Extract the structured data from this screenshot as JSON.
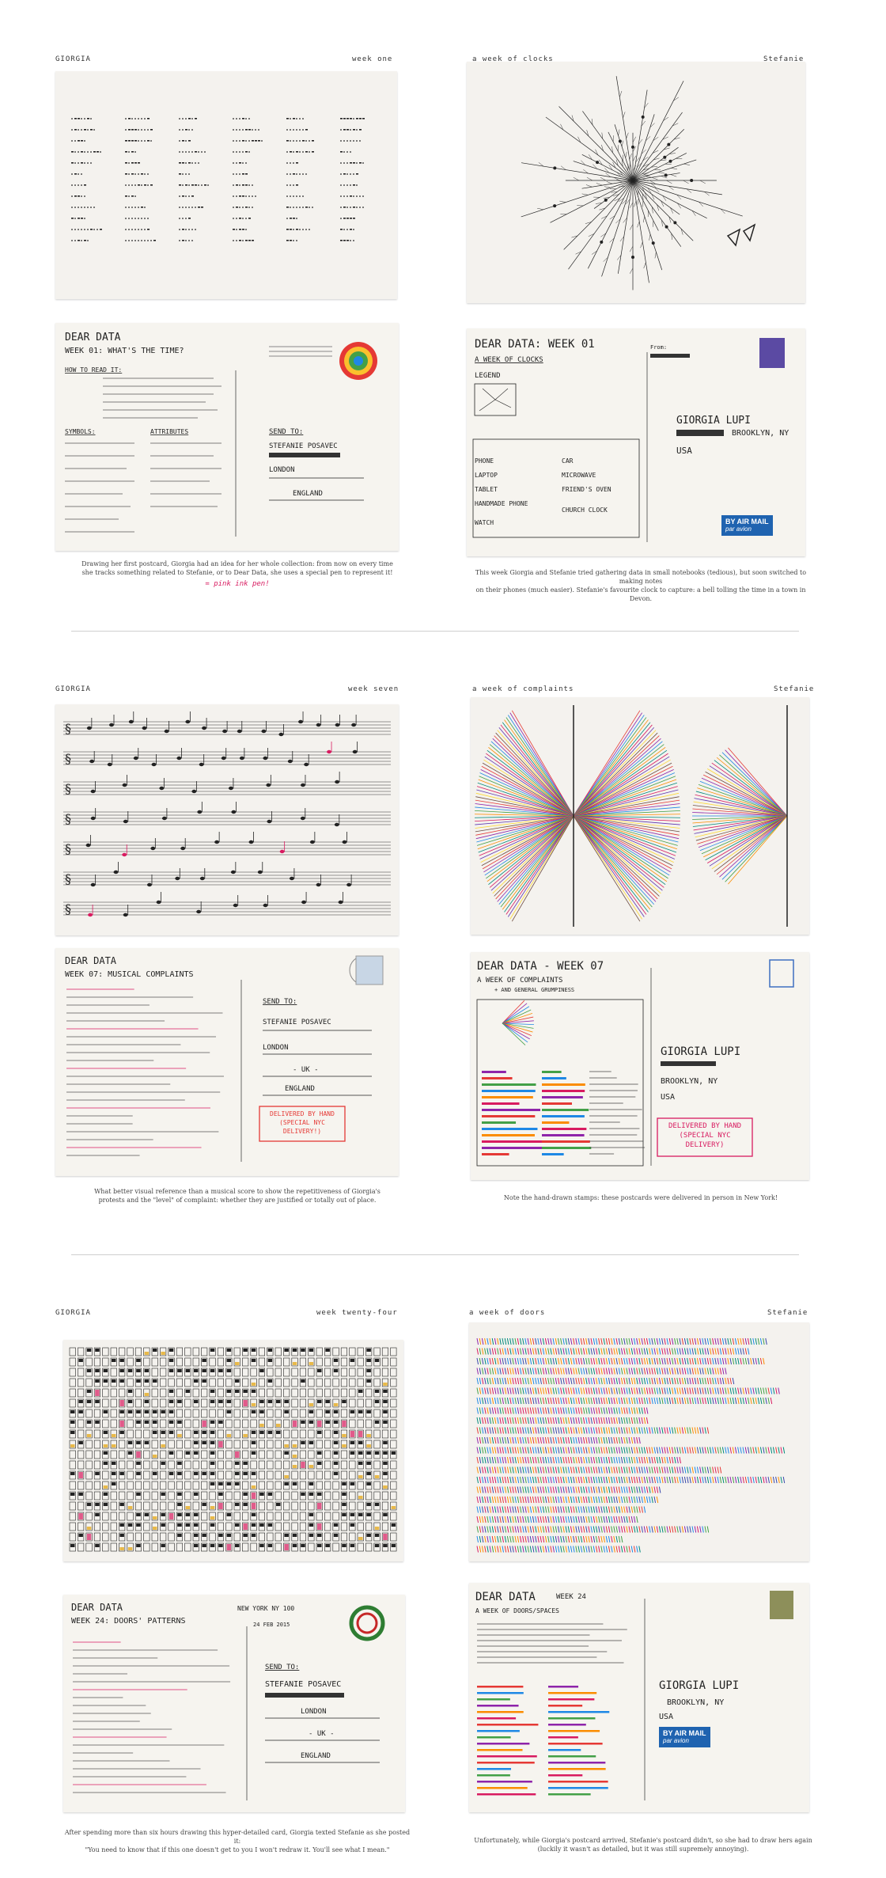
{
  "sections": [
    {
      "left_header": "GIORGIA",
      "left_week": "week one",
      "right_header": "a week of clocks",
      "right_author": "Stefanie",
      "left_caption_line1": "Drawing her first postcard, Giorgia had an idea for her whole collection: from now on every time",
      "left_caption_line2": "she tracks something related to Stefanie, or to Dear Data, she uses a special pen to represent it!",
      "left_caption_note": "= pink ink pen!",
      "right_caption_line1": "This week Giorgia and Stefanie tried gathering data in small notebooks (tedious), but soon switched to making notes",
      "right_caption_line2": "on their phones (much easier). Stefanie's favourite clock to capture: a bell tolling the time in a town in Devon.",
      "g_back_title": "DEAR DATA",
      "g_back_week": "WEEK 01: WHAT'S THE TIME?",
      "g_back_sendto": "SEND TO:",
      "g_back_to_name": "STEFANIE POSAVEC",
      "g_back_to_city": "LONDON",
      "g_back_to_country": "ENGLAND",
      "g_back_howto": "HOW TO READ IT:",
      "g_back_symbols": "SYMBOLS:",
      "g_back_attributes": "ATTRIBUTES",
      "s_back_title": "DEAR DATA: WEEK 01",
      "s_back_subtitle": "A WEEK OF CLOCKS",
      "s_back_legend": "LEGEND",
      "s_back_to_name": "GIORGIA LUPI",
      "s_back_to_city": "BROOKLYN, NY",
      "s_back_to_country": "USA",
      "s_back_from": "From:",
      "s_back_rows": [
        "PHONE",
        "LAPTOP",
        "TABLET",
        "HANDMADE PHONE",
        "WATCH"
      ],
      "s_back_rows2": [
        "CAR",
        "MICROWAVE",
        "FRIEND'S OVEN",
        "CHURCH CLOCK"
      ]
    },
    {
      "left_header": "GIORGIA",
      "left_week": "week seven",
      "right_header": "a week of complaints",
      "right_author": "Stefanie",
      "left_caption_line1": "What better visual reference than a musical score to show the repetitiveness of Giorgia's",
      "left_caption_line2": "protests and the \"level\" of complaint: whether they are justified or totally out of place.",
      "right_caption_line1": "Note the hand-drawn stamps: these postcards were delivered in person in New York!",
      "g_back_title": "DEAR DATA",
      "g_back_week": "WEEK 07: MUSICAL COMPLAINTS",
      "g_back_sendto": "SEND TO:",
      "g_back_to_name": "STEFANIE POSAVEC",
      "g_back_to_city": "LONDON",
      "g_back_to_country": "- UK -",
      "g_back_to_country2": "ENGLAND",
      "g_back_delivered": "DELIVERED BY HAND (SPECIAL NYC DELIVERY!)",
      "s_back_title": "DEAR DATA - WEEK 07",
      "s_back_subtitle": "A WEEK OF COMPLAINTS",
      "s_back_subtitle2": "+ AND GENERAL GRUMPINESS",
      "s_back_to_name": "GIORGIA LUPI",
      "s_back_to_city": "BROOKLYN, NY",
      "s_back_to_country": "USA",
      "s_back_delivered": "DELIVERED BY HAND (SPECIAL NYC DELIVERY)"
    },
    {
      "left_header": "GIORGIA",
      "left_week": "week twenty-four",
      "right_header": "a week of doors",
      "right_author": "Stefanie",
      "left_caption_line1": "After spending more than six hours drawing this hyper-detailed card, Giorgia texted Stefanie as she posted it:",
      "left_caption_line2": "\"You need to know that if this one doesn't get to you I won't redraw it. You'll see what I mean.\"",
      "right_caption_line1": "Unfortunately, while Giorgia's postcard arrived, Stefanie's postcard didn't, so she had to draw hers again",
      "right_caption_line2": "(luckily it wasn't as detailed, but it was still supremely annoying).",
      "g_back_title": "DEAR DATA",
      "g_back_week": "WEEK 24: DOORS' PATTERNS",
      "g_back_sendto": "SEND TO:",
      "g_back_to_name": "STEFANIE POSAVEC",
      "g_back_to_city": "LONDON",
      "g_back_to_country": "- UK -",
      "g_back_to_country2": "ENGLAND",
      "g_back_postmark": "NEW YORK NY 100",
      "g_back_date": "24 FEB 2015",
      "s_back_title": "DEAR DATA",
      "s_back_week": "WEEK 24",
      "s_back_subtitle": "A WEEK OF DOORS/SPACES",
      "s_back_to_name": "GIORGIA LUPI",
      "s_back_to_city": "BROOKLYN, NY",
      "s_back_to_country": "USA"
    }
  ],
  "airmail": {
    "label": "BY AIR MAIL",
    "sub": "par avion"
  },
  "colors": {
    "pink": "#d81b60",
    "airmail_blue": "#1f63b0",
    "card_bg": "#f4f2ee"
  }
}
